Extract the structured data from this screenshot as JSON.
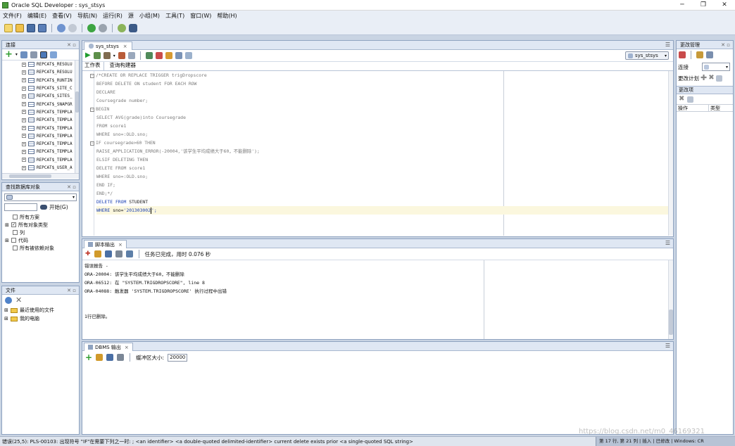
{
  "window": {
    "title": "Oracle SQL Developer : sys_stsys",
    "minimize": "─",
    "maximize": "❐",
    "close": "✕"
  },
  "menu": [
    "文件(F)",
    "编辑(E)",
    "查看(V)",
    "导航(N)",
    "运行(R)",
    "源",
    "小组(M)",
    "工具(T)",
    "窗口(W)",
    "帮助(H)"
  ],
  "connections_panel": {
    "title": "连接",
    "items": [
      "REPCAT$_RESOLU",
      "REPCAT$_RESOLU",
      "REPCAT$_RUNTIN",
      "REPCAT$_SITE_C",
      "REPCAT$_SITES_",
      "REPCAT$_SNAPGR",
      "REPCAT$_TEMPLA",
      "REPCAT$_TEMPLA",
      "REPCAT$_TEMPLA",
      "REPCAT$_TEMPLA",
      "REPCAT$_TEMPLA",
      "REPCAT$_TEMPLA",
      "REPCAT$_TEMPLA",
      "REPCAT$_USER_A"
    ]
  },
  "find_panel": {
    "title": "查找数据库对象",
    "search_button": "开始(G)",
    "options": [
      {
        "label": "所有方案",
        "checked": false
      },
      {
        "label": "所有对象类型",
        "checked": true
      },
      {
        "label": "列",
        "checked": false
      },
      {
        "label": "代码",
        "checked": false
      },
      {
        "label": "所有被依赖对象",
        "checked": false
      }
    ]
  },
  "files_panel": {
    "title": "文件",
    "items": [
      "最近使用的文件",
      "我的电脑"
    ]
  },
  "editor": {
    "tab": "sys_stsys",
    "connection": "sys_stsys",
    "subtabs": [
      "工作表",
      "查询构建器"
    ],
    "lines": [
      {
        "fold": "⊟",
        "text": "/*CREATE OR REPLACE TRIGGER trigDropscore"
      },
      {
        "fold": "",
        "text": "BEFORE DELETE ON student FOR EACH ROW"
      },
      {
        "fold": "",
        "text": "DECLARE"
      },
      {
        "fold": "",
        "text": "Coursegrade number;"
      },
      {
        "fold": "⊟",
        "text": "BEGIN"
      },
      {
        "fold": "",
        "text": "SELECT AVG(grade)into Coursegrade"
      },
      {
        "fold": "",
        "text": "FROM score1"
      },
      {
        "fold": "",
        "text": "WHERE sno=:OLD.sno;"
      },
      {
        "fold": "⊟",
        "text": "IF coursegrade>60 THEN"
      },
      {
        "fold": "",
        "text": "RAISE_APPLICATION_ERROR(-20004,'该学生平均成绩大于60，不能删除');"
      },
      {
        "fold": "",
        "text": "ELSIF DELETING THEN"
      },
      {
        "fold": "",
        "text": "DELETE FROM score1"
      },
      {
        "fold": "",
        "text": "WHERE sno=:OLD.sno;"
      },
      {
        "fold": "",
        "text": "END IF;"
      },
      {
        "fold": "",
        "text": "END;*/"
      }
    ],
    "active_line1": {
      "kw1": "DELETE",
      "kw2": "FROM",
      "rest": " STUDENT"
    },
    "active_line2": {
      "kw": "WHERE",
      "mid": " sno=",
      "str1": "'201303002",
      "str2": "';"
    }
  },
  "script_output": {
    "tab": "脚本输出",
    "status": "任务已完成，用时 0.076 秒",
    "lines": [
      "错误报告 -",
      "ORA-20004: 该学生平均成绩大于60，不能删除",
      "ORA-06512: 在 \"SYSTEM.TRIGDROPSCORE\", line 8",
      "ORA-04088: 触发器 'SYSTEM.TRIGDROPSCORE' 执行过程中出错",
      "",
      "",
      "1行已删除。"
    ]
  },
  "dbms_output": {
    "tab": "DBMS 输出",
    "buffer_label": "缓冲区大小:",
    "buffer_value": "20000"
  },
  "change_panel": {
    "title": "更改管理",
    "connection_label": "连接",
    "plan_label": "更改计划",
    "items_title": "更改项",
    "columns": [
      "操作",
      "类型"
    ]
  },
  "statusbar": {
    "left": "错误(25,5): PLS-00103: 出现符号 \"IF\"在需要下列之一时:   ; <an identifier>   <a double-quoted delimited-identifier> current delete exists   prior <a single-quoted SQL string>",
    "right": "第 17 行, 第 21 列 | 插入 | 已修改 | Windows: CR"
  },
  "watermark": "https://blog.csdn.net/m0_46169321"
}
